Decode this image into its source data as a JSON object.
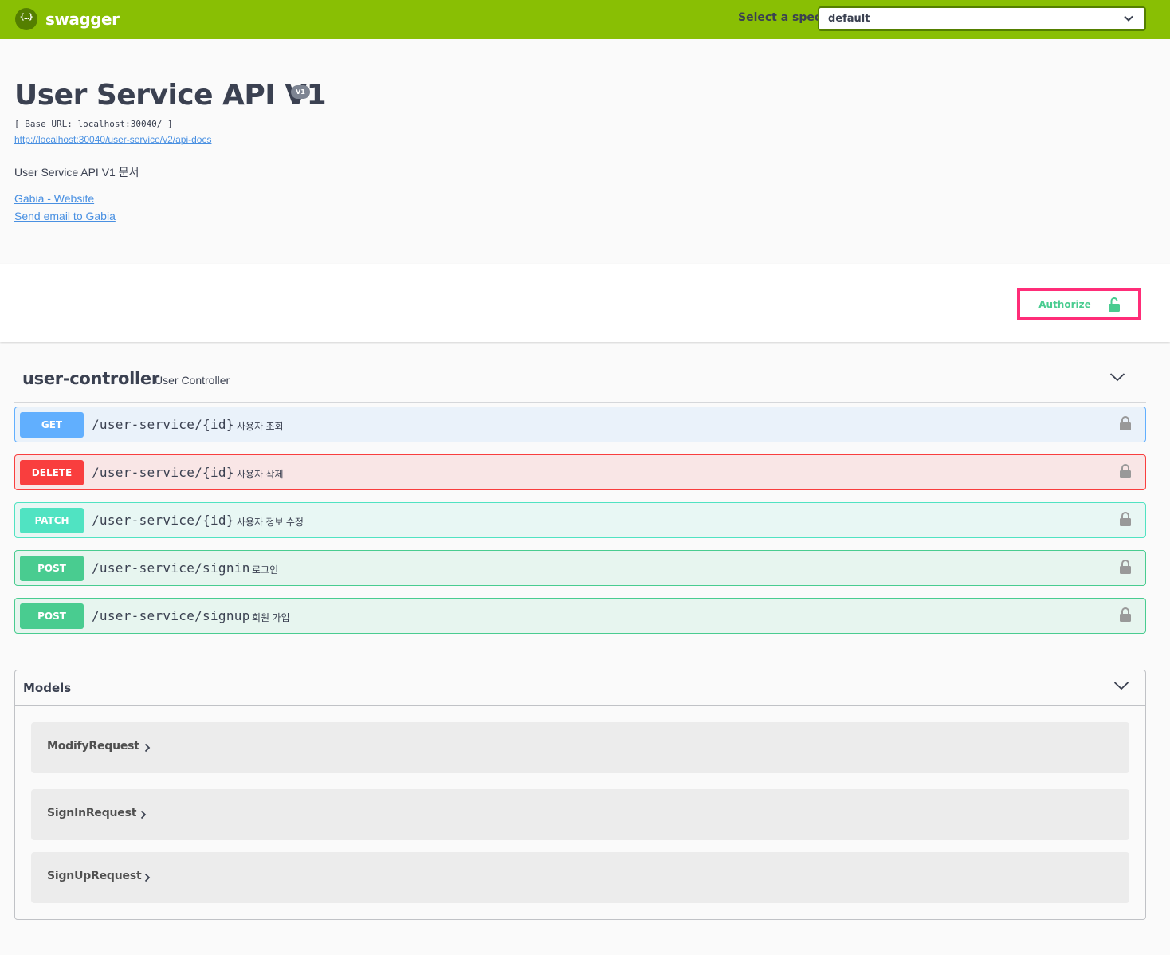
{
  "topbar": {
    "logo_glyph": "{…}",
    "logo_text": "swagger",
    "select_label": "Select a spec",
    "select_value": "default"
  },
  "info": {
    "title": "User Service API V1",
    "version": "V1",
    "base_url": "[ Base URL: localhost:30040/ ]",
    "docs_link": "http://localhost:30040/user-service/v2/api-docs",
    "description": "User Service API V1 문서",
    "contact_website": "Gabia - Website",
    "contact_email": "Send email to Gabia"
  },
  "authorize": {
    "label": "Authorize"
  },
  "tag": {
    "name": "user-controller",
    "description": "User Controller"
  },
  "operations": [
    {
      "method": "GET",
      "path": "/user-service/{id}",
      "summary": "사용자 조회"
    },
    {
      "method": "DELETE",
      "path": "/user-service/{id}",
      "summary": "사용자 삭제"
    },
    {
      "method": "PATCH",
      "path": "/user-service/{id}",
      "summary": "사용자 정보 수정"
    },
    {
      "method": "POST",
      "path": "/user-service/signin",
      "summary": "로그인"
    },
    {
      "method": "POST",
      "path": "/user-service/signup",
      "summary": "회원 가입"
    }
  ],
  "models": {
    "title": "Models",
    "items": [
      "ModifyRequest",
      "SignInRequest",
      "SignUpRequest"
    ]
  },
  "colors": {
    "topbar": "#89bf04",
    "get": "#61affe",
    "delete": "#f93e3e",
    "patch": "#50e3c2",
    "post": "#49cc90",
    "highlight": "#ff2d78"
  }
}
